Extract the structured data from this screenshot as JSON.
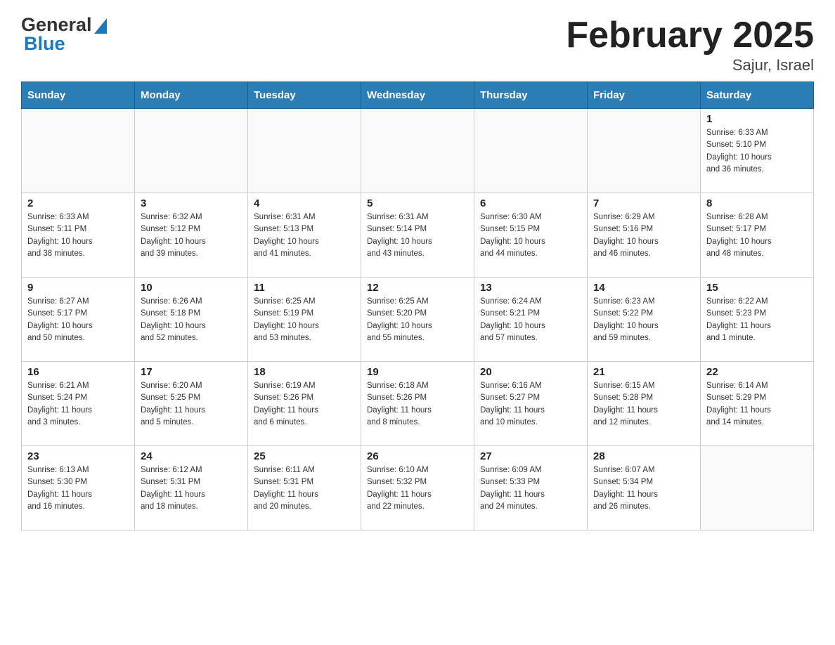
{
  "header": {
    "title": "February 2025",
    "subtitle": "Sajur, Israel"
  },
  "logo": {
    "general": "General",
    "blue": "Blue"
  },
  "days_of_week": [
    "Sunday",
    "Monday",
    "Tuesday",
    "Wednesday",
    "Thursday",
    "Friday",
    "Saturday"
  ],
  "weeks": [
    {
      "days": [
        {
          "number": "",
          "info": ""
        },
        {
          "number": "",
          "info": ""
        },
        {
          "number": "",
          "info": ""
        },
        {
          "number": "",
          "info": ""
        },
        {
          "number": "",
          "info": ""
        },
        {
          "number": "",
          "info": ""
        },
        {
          "number": "1",
          "info": "Sunrise: 6:33 AM\nSunset: 5:10 PM\nDaylight: 10 hours\nand 36 minutes."
        }
      ]
    },
    {
      "days": [
        {
          "number": "2",
          "info": "Sunrise: 6:33 AM\nSunset: 5:11 PM\nDaylight: 10 hours\nand 38 minutes."
        },
        {
          "number": "3",
          "info": "Sunrise: 6:32 AM\nSunset: 5:12 PM\nDaylight: 10 hours\nand 39 minutes."
        },
        {
          "number": "4",
          "info": "Sunrise: 6:31 AM\nSunset: 5:13 PM\nDaylight: 10 hours\nand 41 minutes."
        },
        {
          "number": "5",
          "info": "Sunrise: 6:31 AM\nSunset: 5:14 PM\nDaylight: 10 hours\nand 43 minutes."
        },
        {
          "number": "6",
          "info": "Sunrise: 6:30 AM\nSunset: 5:15 PM\nDaylight: 10 hours\nand 44 minutes."
        },
        {
          "number": "7",
          "info": "Sunrise: 6:29 AM\nSunset: 5:16 PM\nDaylight: 10 hours\nand 46 minutes."
        },
        {
          "number": "8",
          "info": "Sunrise: 6:28 AM\nSunset: 5:17 PM\nDaylight: 10 hours\nand 48 minutes."
        }
      ]
    },
    {
      "days": [
        {
          "number": "9",
          "info": "Sunrise: 6:27 AM\nSunset: 5:17 PM\nDaylight: 10 hours\nand 50 minutes."
        },
        {
          "number": "10",
          "info": "Sunrise: 6:26 AM\nSunset: 5:18 PM\nDaylight: 10 hours\nand 52 minutes."
        },
        {
          "number": "11",
          "info": "Sunrise: 6:25 AM\nSunset: 5:19 PM\nDaylight: 10 hours\nand 53 minutes."
        },
        {
          "number": "12",
          "info": "Sunrise: 6:25 AM\nSunset: 5:20 PM\nDaylight: 10 hours\nand 55 minutes."
        },
        {
          "number": "13",
          "info": "Sunrise: 6:24 AM\nSunset: 5:21 PM\nDaylight: 10 hours\nand 57 minutes."
        },
        {
          "number": "14",
          "info": "Sunrise: 6:23 AM\nSunset: 5:22 PM\nDaylight: 10 hours\nand 59 minutes."
        },
        {
          "number": "15",
          "info": "Sunrise: 6:22 AM\nSunset: 5:23 PM\nDaylight: 11 hours\nand 1 minute."
        }
      ]
    },
    {
      "days": [
        {
          "number": "16",
          "info": "Sunrise: 6:21 AM\nSunset: 5:24 PM\nDaylight: 11 hours\nand 3 minutes."
        },
        {
          "number": "17",
          "info": "Sunrise: 6:20 AM\nSunset: 5:25 PM\nDaylight: 11 hours\nand 5 minutes."
        },
        {
          "number": "18",
          "info": "Sunrise: 6:19 AM\nSunset: 5:26 PM\nDaylight: 11 hours\nand 6 minutes."
        },
        {
          "number": "19",
          "info": "Sunrise: 6:18 AM\nSunset: 5:26 PM\nDaylight: 11 hours\nand 8 minutes."
        },
        {
          "number": "20",
          "info": "Sunrise: 6:16 AM\nSunset: 5:27 PM\nDaylight: 11 hours\nand 10 minutes."
        },
        {
          "number": "21",
          "info": "Sunrise: 6:15 AM\nSunset: 5:28 PM\nDaylight: 11 hours\nand 12 minutes."
        },
        {
          "number": "22",
          "info": "Sunrise: 6:14 AM\nSunset: 5:29 PM\nDaylight: 11 hours\nand 14 minutes."
        }
      ]
    },
    {
      "days": [
        {
          "number": "23",
          "info": "Sunrise: 6:13 AM\nSunset: 5:30 PM\nDaylight: 11 hours\nand 16 minutes."
        },
        {
          "number": "24",
          "info": "Sunrise: 6:12 AM\nSunset: 5:31 PM\nDaylight: 11 hours\nand 18 minutes."
        },
        {
          "number": "25",
          "info": "Sunrise: 6:11 AM\nSunset: 5:31 PM\nDaylight: 11 hours\nand 20 minutes."
        },
        {
          "number": "26",
          "info": "Sunrise: 6:10 AM\nSunset: 5:32 PM\nDaylight: 11 hours\nand 22 minutes."
        },
        {
          "number": "27",
          "info": "Sunrise: 6:09 AM\nSunset: 5:33 PM\nDaylight: 11 hours\nand 24 minutes."
        },
        {
          "number": "28",
          "info": "Sunrise: 6:07 AM\nSunset: 5:34 PM\nDaylight: 11 hours\nand 26 minutes."
        },
        {
          "number": "",
          "info": ""
        }
      ]
    }
  ]
}
